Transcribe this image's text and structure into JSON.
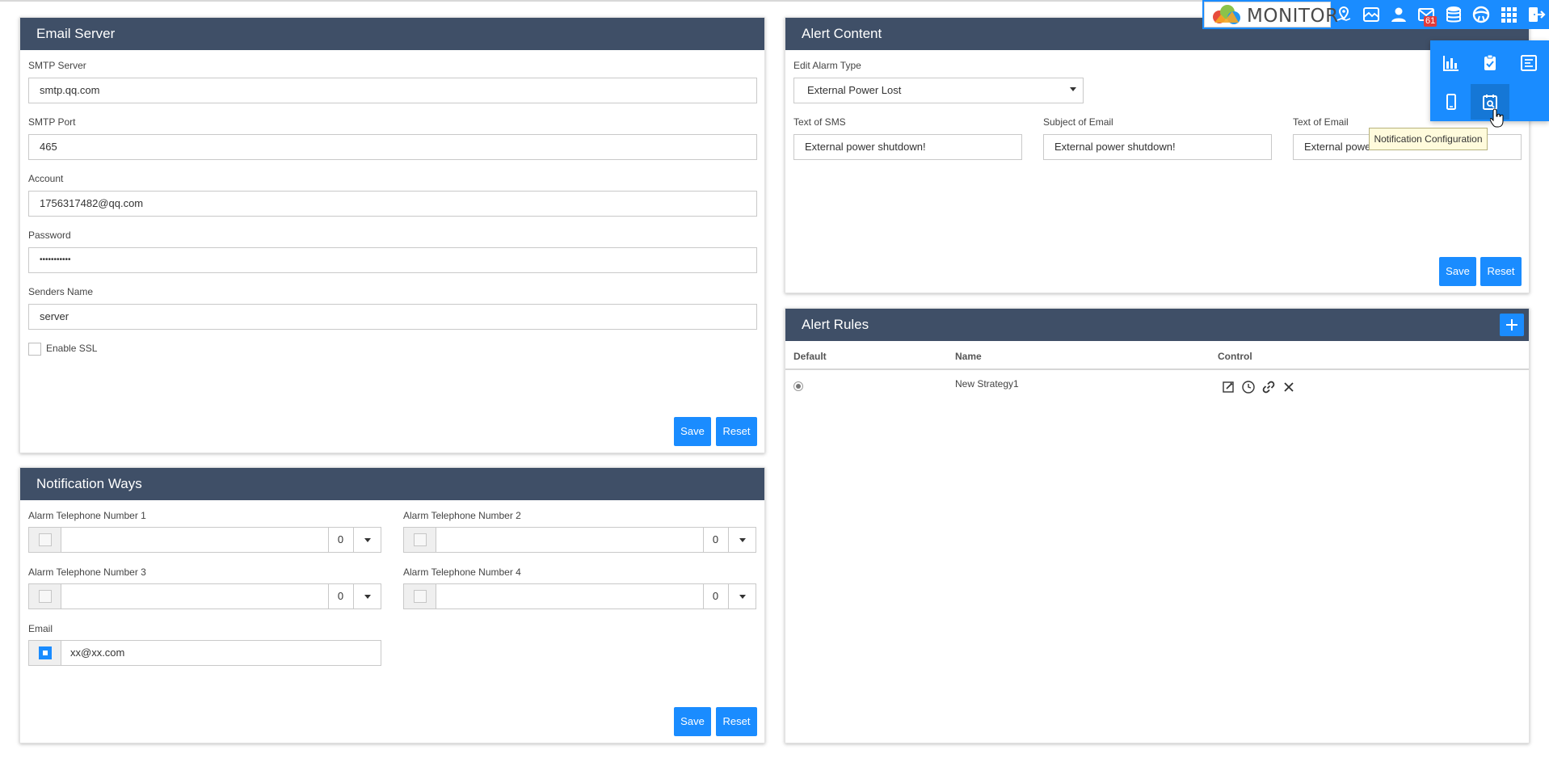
{
  "header": {
    "brand": "MONITOR",
    "mail_badge": "61",
    "icons": [
      "map-pin-icon",
      "map-icon",
      "user-icon",
      "mail-icon",
      "database-icon",
      "steering-wheel-icon",
      "grid-icon",
      "logout-icon"
    ]
  },
  "email_server": {
    "title": "Email Server",
    "smtp_server_label": "SMTP Server",
    "smtp_server_value": "smtp.qq.com",
    "smtp_port_label": "SMTP Port",
    "smtp_port_value": "465",
    "account_label": "Account",
    "account_value": "1756317482@qq.com",
    "password_label": "Password",
    "password_value": "•••••••••••",
    "senders_name_label": "Senders Name",
    "senders_name_value": "server",
    "ssl_label": "Enable SSL",
    "save_label": "Save",
    "reset_label": "Reset"
  },
  "notification_ways": {
    "title": "Notification Ways",
    "phone1_label": "Alarm Telephone Number 1",
    "phone1_code": "0",
    "phone2_label": "Alarm Telephone Number 2",
    "phone2_code": "0",
    "phone3_label": "Alarm Telephone Number 3",
    "phone3_code": "0",
    "phone4_label": "Alarm Telephone Number 4",
    "phone4_code": "0",
    "email_label": "Email",
    "email_value": "xx@xx.com",
    "save_label": "Save",
    "reset_label": "Reset"
  },
  "alert_content": {
    "title": "Alert Content",
    "alarm_type_label": "Edit Alarm Type",
    "alarm_type_value": "External Power Lost",
    "sms_label": "Text of SMS",
    "sms_value": "External power shutdown!",
    "subject_label": "Subject of Email",
    "subject_value": "External power shutdown!",
    "email_text_label": "Text of Email",
    "email_text_value": "External power shutdown!",
    "save_label": "Save",
    "reset_label": "Reset"
  },
  "alert_rules": {
    "title": "Alert Rules",
    "columns": [
      "Default",
      "Name",
      "Control"
    ],
    "rows": [
      {
        "name": "New Strategy1"
      }
    ]
  },
  "dropdown_menu": {
    "icons": [
      "bar-chart-icon",
      "clipboard-check-icon",
      "report-icon",
      "phone-icon",
      "notification-config-icon"
    ],
    "tooltip": "Notification Configuration"
  },
  "colors": {
    "panel_header": "#3f4f67",
    "accent": "#1a8cff"
  }
}
